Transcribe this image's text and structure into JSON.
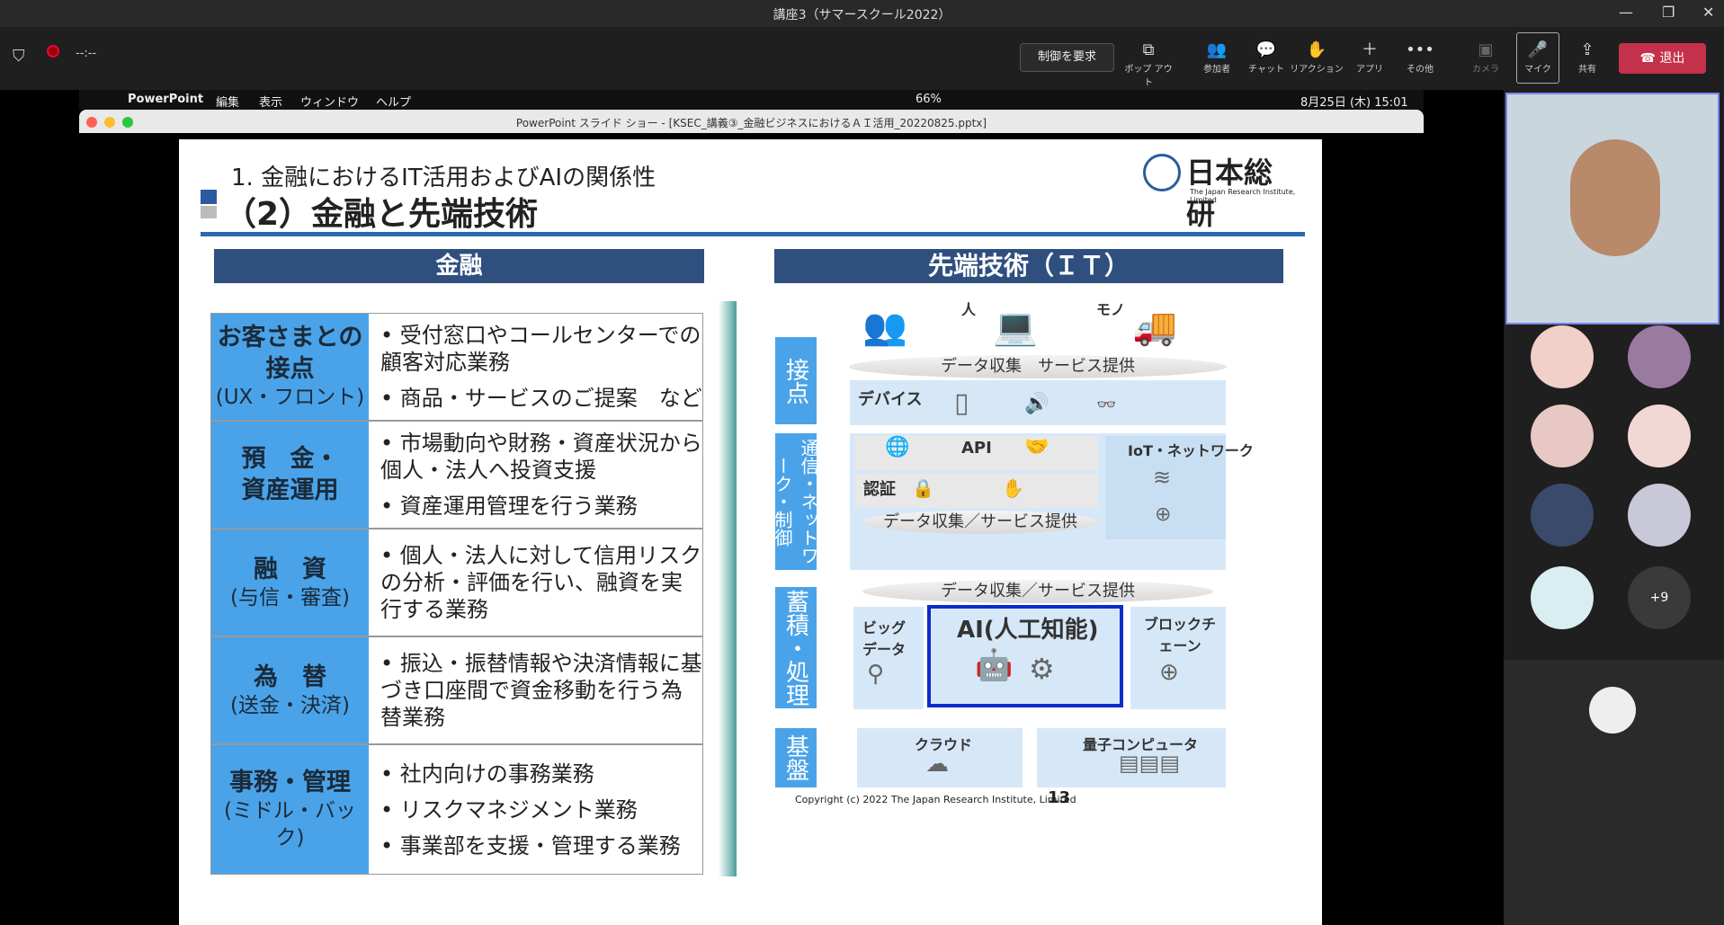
{
  "window": {
    "title": "講座3（サマースクール2022）"
  },
  "meeting": {
    "timer": "--:--",
    "request_control": "制御を要求",
    "popout": "ポップ アウト",
    "participants": "参加者",
    "chat": "チャット",
    "reactions": "リアクション",
    "apps": "アプリ",
    "more": "その他",
    "camera": "カメラ",
    "mic": "マイク",
    "share": "共有",
    "leave": "退出",
    "extra_count": "+9"
  },
  "mac": {
    "app": "PowerPoint",
    "menu": [
      "編集",
      "表示",
      "ウィンドウ",
      "ヘルプ"
    ],
    "battery": "66%",
    "datetime": "8月25日 (木)  15:01"
  },
  "ppt": {
    "title": "PowerPoint スライド ショー - [KSEC_講義③_金融ビジネスにおけるＡＩ活用_20220825.pptx]"
  },
  "slide": {
    "heading": "1. 金融におけるIT活用およびAIの関係性",
    "subheading": "（2）金融と先端技術",
    "logo": "日本総研",
    "logo_sub": "The Japan Research Institute, Limited",
    "left_header": "金融",
    "right_header": "先端技術（ＩＴ）",
    "rows": [
      {
        "t1": "お客さまとの",
        "t2": "接点",
        "sub": "(UX・フロント)",
        "items": [
          "受付窓口やコールセンターでの顧客対応業務",
          "商品・サービスのご提案　など"
        ]
      },
      {
        "t1": "預　金・",
        "t2": "資産運用",
        "sub": "",
        "items": [
          "市場動向や財務・資産状況から個人・法人へ投資支援",
          "資産運用管理を行う業務"
        ]
      },
      {
        "t1": "融　資",
        "t2": "",
        "sub": "(与信・審査)",
        "items": [
          "個人・法人に対して信用リスクの分析・評価を行い、融資を実行する業務"
        ]
      },
      {
        "t1": "為　替",
        "t2": "",
        "sub": "(送金・決済)",
        "items": [
          "振込・振替情報や決済情報に基づき口座間で資金移動を行う為替業務"
        ]
      },
      {
        "t1": "事務・管理",
        "t2": "",
        "sub": "(ミドル・バック)",
        "items": [
          "社内向けの事務業務",
          "リスクマネジメント業務",
          "事業部を支援・管理する業務"
        ]
      }
    ],
    "people": "人",
    "things": "モノ",
    "contact": "接点",
    "collect1": "データ収集　サービス提供",
    "device": "デバイス",
    "network": "通信・ネットワーク・制御",
    "api": "API",
    "iot": "IoT・ネットワーク",
    "auth": "認証",
    "collect2": "データ収集／サービス提供",
    "collect3": "データ収集／サービス提供",
    "storage": "蓄積・処理",
    "bigdata": "ビッグデータ",
    "ai": "AI(人工知能)",
    "blockchain": "ブロックチェーン",
    "base": "基盤",
    "cloud": "クラウド",
    "quantum": "量子コンピュータ",
    "copyright": "Copyright (c) 2022 The Japan Research Institute, Limited",
    "page": "13"
  }
}
